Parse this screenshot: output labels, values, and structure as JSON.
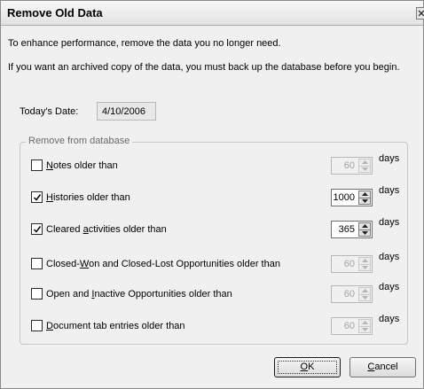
{
  "dialog": {
    "title": "Remove Old Data",
    "intro_line1": "To enhance performance, remove the data you no longer need.",
    "intro_line2": "If you want an archived copy of the data, you must back up the database before you begin."
  },
  "date": {
    "label": "Today's Date:",
    "value": "4/10/2006"
  },
  "group": {
    "label": "Remove from database",
    "days_label": "days",
    "rows": [
      {
        "label_pre": "",
        "label_u": "N",
        "label_post": "otes older than",
        "checked": false,
        "value": "60",
        "enabled": false
      },
      {
        "label_pre": "",
        "label_u": "H",
        "label_post": "istories older than",
        "checked": true,
        "value": "1000",
        "enabled": true
      },
      {
        "label_pre": "Cleared ",
        "label_u": "a",
        "label_post": "ctivities older than",
        "checked": true,
        "value": "365",
        "enabled": true
      },
      {
        "label_pre": "Closed-",
        "label_u": "W",
        "label_post": "on and Closed-Lost Opportunities older than",
        "checked": false,
        "value": "60",
        "enabled": false
      },
      {
        "label_pre": "Open and ",
        "label_u": "I",
        "label_post": "nactive Opportunities older than",
        "checked": false,
        "value": "60",
        "enabled": false
      },
      {
        "label_pre": "",
        "label_u": "D",
        "label_post": "ocument tab entries older than",
        "checked": false,
        "value": "60",
        "enabled": false
      }
    ]
  },
  "buttons": {
    "ok_u": "O",
    "ok_rest": "K",
    "cancel_u": "C",
    "cancel_rest": "ancel"
  },
  "icons": {
    "close": "close-icon",
    "check": "checkmark-icon",
    "spin_up": "arrow-up-icon",
    "spin_down": "arrow-down-icon"
  }
}
